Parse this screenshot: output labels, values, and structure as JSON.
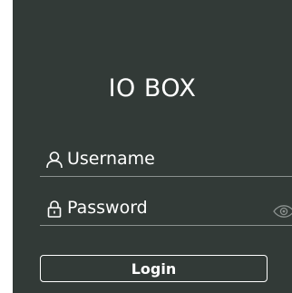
{
  "form": {
    "title": "IO BOX",
    "username": {
      "placeholder": "Username",
      "icon": "user-icon"
    },
    "password": {
      "placeholder": "Password",
      "icon": "lock-icon",
      "toggle_icon": "eye-icon"
    },
    "login_label": "Login"
  },
  "colors": {
    "panel_background": "#323a37",
    "text": "#ffffff",
    "divider": "#8b918f",
    "eye_icon": "#8b918f"
  }
}
